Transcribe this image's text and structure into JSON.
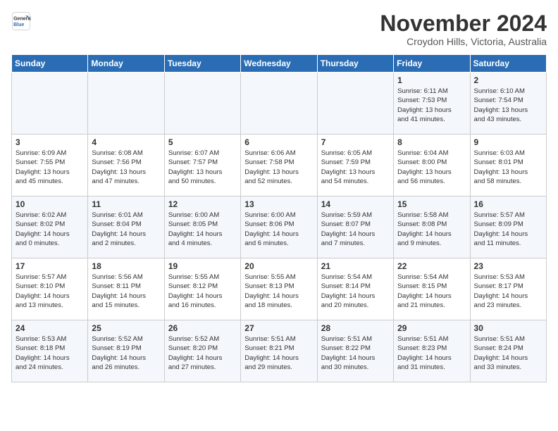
{
  "logo": {
    "line1": "General",
    "line2": "Blue"
  },
  "title": "November 2024",
  "subtitle": "Croydon Hills, Victoria, Australia",
  "headers": [
    "Sunday",
    "Monday",
    "Tuesday",
    "Wednesday",
    "Thursday",
    "Friday",
    "Saturday"
  ],
  "weeks": [
    [
      {
        "day": "",
        "detail": ""
      },
      {
        "day": "",
        "detail": ""
      },
      {
        "day": "",
        "detail": ""
      },
      {
        "day": "",
        "detail": ""
      },
      {
        "day": "",
        "detail": ""
      },
      {
        "day": "1",
        "detail": "Sunrise: 6:11 AM\nSunset: 7:53 PM\nDaylight: 13 hours\nand 41 minutes."
      },
      {
        "day": "2",
        "detail": "Sunrise: 6:10 AM\nSunset: 7:54 PM\nDaylight: 13 hours\nand 43 minutes."
      }
    ],
    [
      {
        "day": "3",
        "detail": "Sunrise: 6:09 AM\nSunset: 7:55 PM\nDaylight: 13 hours\nand 45 minutes."
      },
      {
        "day": "4",
        "detail": "Sunrise: 6:08 AM\nSunset: 7:56 PM\nDaylight: 13 hours\nand 47 minutes."
      },
      {
        "day": "5",
        "detail": "Sunrise: 6:07 AM\nSunset: 7:57 PM\nDaylight: 13 hours\nand 50 minutes."
      },
      {
        "day": "6",
        "detail": "Sunrise: 6:06 AM\nSunset: 7:58 PM\nDaylight: 13 hours\nand 52 minutes."
      },
      {
        "day": "7",
        "detail": "Sunrise: 6:05 AM\nSunset: 7:59 PM\nDaylight: 13 hours\nand 54 minutes."
      },
      {
        "day": "8",
        "detail": "Sunrise: 6:04 AM\nSunset: 8:00 PM\nDaylight: 13 hours\nand 56 minutes."
      },
      {
        "day": "9",
        "detail": "Sunrise: 6:03 AM\nSunset: 8:01 PM\nDaylight: 13 hours\nand 58 minutes."
      }
    ],
    [
      {
        "day": "10",
        "detail": "Sunrise: 6:02 AM\nSunset: 8:02 PM\nDaylight: 14 hours\nand 0 minutes."
      },
      {
        "day": "11",
        "detail": "Sunrise: 6:01 AM\nSunset: 8:04 PM\nDaylight: 14 hours\nand 2 minutes."
      },
      {
        "day": "12",
        "detail": "Sunrise: 6:00 AM\nSunset: 8:05 PM\nDaylight: 14 hours\nand 4 minutes."
      },
      {
        "day": "13",
        "detail": "Sunrise: 6:00 AM\nSunset: 8:06 PM\nDaylight: 14 hours\nand 6 minutes."
      },
      {
        "day": "14",
        "detail": "Sunrise: 5:59 AM\nSunset: 8:07 PM\nDaylight: 14 hours\nand 7 minutes."
      },
      {
        "day": "15",
        "detail": "Sunrise: 5:58 AM\nSunset: 8:08 PM\nDaylight: 14 hours\nand 9 minutes."
      },
      {
        "day": "16",
        "detail": "Sunrise: 5:57 AM\nSunset: 8:09 PM\nDaylight: 14 hours\nand 11 minutes."
      }
    ],
    [
      {
        "day": "17",
        "detail": "Sunrise: 5:57 AM\nSunset: 8:10 PM\nDaylight: 14 hours\nand 13 minutes."
      },
      {
        "day": "18",
        "detail": "Sunrise: 5:56 AM\nSunset: 8:11 PM\nDaylight: 14 hours\nand 15 minutes."
      },
      {
        "day": "19",
        "detail": "Sunrise: 5:55 AM\nSunset: 8:12 PM\nDaylight: 14 hours\nand 16 minutes."
      },
      {
        "day": "20",
        "detail": "Sunrise: 5:55 AM\nSunset: 8:13 PM\nDaylight: 14 hours\nand 18 minutes."
      },
      {
        "day": "21",
        "detail": "Sunrise: 5:54 AM\nSunset: 8:14 PM\nDaylight: 14 hours\nand 20 minutes."
      },
      {
        "day": "22",
        "detail": "Sunrise: 5:54 AM\nSunset: 8:15 PM\nDaylight: 14 hours\nand 21 minutes."
      },
      {
        "day": "23",
        "detail": "Sunrise: 5:53 AM\nSunset: 8:17 PM\nDaylight: 14 hours\nand 23 minutes."
      }
    ],
    [
      {
        "day": "24",
        "detail": "Sunrise: 5:53 AM\nSunset: 8:18 PM\nDaylight: 14 hours\nand 24 minutes."
      },
      {
        "day": "25",
        "detail": "Sunrise: 5:52 AM\nSunset: 8:19 PM\nDaylight: 14 hours\nand 26 minutes."
      },
      {
        "day": "26",
        "detail": "Sunrise: 5:52 AM\nSunset: 8:20 PM\nDaylight: 14 hours\nand 27 minutes."
      },
      {
        "day": "27",
        "detail": "Sunrise: 5:51 AM\nSunset: 8:21 PM\nDaylight: 14 hours\nand 29 minutes."
      },
      {
        "day": "28",
        "detail": "Sunrise: 5:51 AM\nSunset: 8:22 PM\nDaylight: 14 hours\nand 30 minutes."
      },
      {
        "day": "29",
        "detail": "Sunrise: 5:51 AM\nSunset: 8:23 PM\nDaylight: 14 hours\nand 31 minutes."
      },
      {
        "day": "30",
        "detail": "Sunrise: 5:51 AM\nSunset: 8:24 PM\nDaylight: 14 hours\nand 33 minutes."
      }
    ]
  ]
}
